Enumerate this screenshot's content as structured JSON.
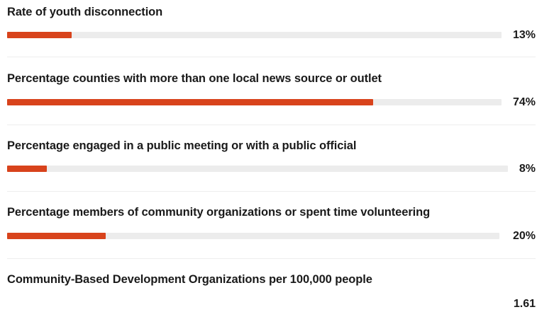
{
  "colors": {
    "bar_fill": "#d8431c",
    "bar_track": "#ececec"
  },
  "chart_data": {
    "type": "bar",
    "orientation": "horizontal",
    "categories": [
      "Rate of youth disconnection",
      "Percentage counties with more than one local news source or outlet",
      "Percentage engaged in a public meeting or with a public official",
      "Percentage members of community organizations or spent time volunteering",
      "Community-Based Development Organizations per 100,000 people"
    ],
    "values": [
      13,
      74,
      8,
      20,
      1.61
    ],
    "value_labels": [
      "13%",
      "74%",
      "8%",
      "20%",
      "1.61"
    ],
    "bar_shown": [
      true,
      true,
      true,
      true,
      false
    ],
    "xlim": [
      0,
      100
    ]
  }
}
